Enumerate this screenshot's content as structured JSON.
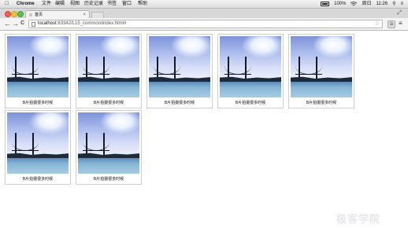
{
  "menubar": {
    "app": "Chrome",
    "items": [
      "文件",
      "编辑",
      "视图",
      "历史记录",
      "书签",
      "窗口",
      "帮助"
    ],
    "battery": "100%",
    "day": "周日",
    "time": "11:26"
  },
  "tab": {
    "title": "首页",
    "close": "×"
  },
  "nav": {
    "back": "←",
    "forward": "→",
    "reload": "C"
  },
  "address": {
    "host": "localhost",
    "path": ":63342/L15_common/index.html#"
  },
  "toolbar": {
    "star": "☆",
    "menu": "≡",
    "ext": "⊞"
  },
  "gallery": {
    "caption": "B片拍摄很多时候",
    "items": [
      {
        "caption": "B片拍摄很多时候"
      },
      {
        "caption": "B片拍摄很多时候"
      },
      {
        "caption": "B片拍摄很多时候"
      },
      {
        "caption": "B片拍摄很多时候"
      },
      {
        "caption": "B片拍摄很多时候"
      },
      {
        "caption": "B片拍摄很多时候"
      },
      {
        "caption": "B片拍摄很多时候"
      }
    ]
  },
  "watermark": "极客学院",
  "colors": {
    "accent": "#4e7fae",
    "sky": "#a9b9ec"
  }
}
